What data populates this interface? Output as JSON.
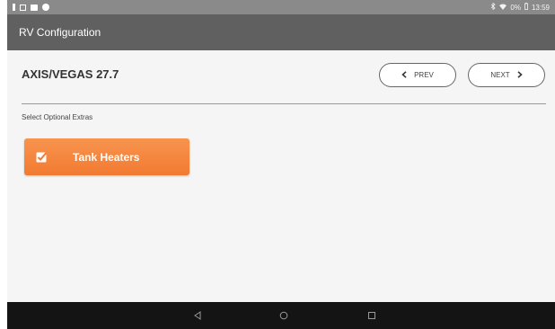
{
  "status_bar": {
    "time": "13:59",
    "battery": "0%"
  },
  "app_bar": {
    "title": "RV Configuration"
  },
  "main": {
    "rv_name": "AXIS/VEGAS 27.7",
    "prev_label": "PREV",
    "next_label": "NEXT",
    "section_label": "Select Optional Extras",
    "extras": [
      {
        "label": "Tank Heaters",
        "checked": true
      }
    ]
  },
  "colors": {
    "app_bar": "#606060",
    "status_bar": "#8a8a8a",
    "accent_orange": "#f58a3f",
    "nav_bar": "#141414"
  },
  "icons": {
    "prev": "chevron-left-icon",
    "next": "chevron-right-icon",
    "checkbox": "check-icon",
    "back": "back-triangle-icon",
    "home": "home-circle-icon",
    "recent": "recent-square-icon"
  }
}
